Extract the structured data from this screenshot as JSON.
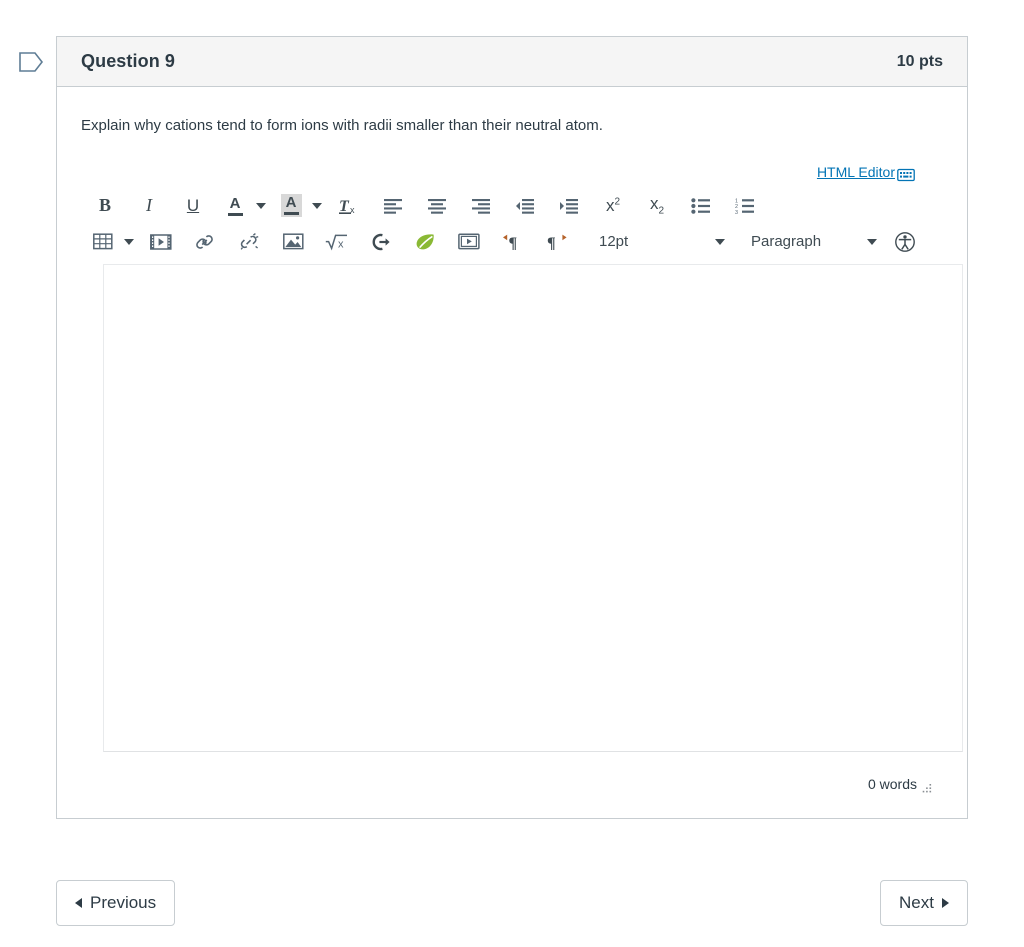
{
  "question": {
    "flag_icon": "flag-bookmark-icon",
    "title": "Question 9",
    "points": "10 pts",
    "prompt": "Explain why cations tend to form ions with radii smaller than their neutral atom."
  },
  "editor": {
    "html_editor_link": "HTML Editor",
    "html_editor_icon": "keyboard-icon",
    "content": "",
    "word_count": "0 words",
    "resize_handle_icon": "resize-grip-icon",
    "toolbar_row1": [
      {
        "name": "bold-button",
        "label": "B",
        "icon": "bold-icon"
      },
      {
        "name": "italic-button",
        "label": "I",
        "icon": "italic-icon"
      },
      {
        "name": "underline-button",
        "label": "U",
        "icon": "underline-icon"
      },
      {
        "name": "text-color-button",
        "label": "A",
        "icon": "text-color-icon"
      },
      {
        "name": "text-color-dropdown",
        "label": "",
        "icon": "chevron-down-icon"
      },
      {
        "name": "highlight-color-button",
        "label": "A",
        "icon": "highlight-color-icon"
      },
      {
        "name": "highlight-color-dropdown",
        "label": "",
        "icon": "chevron-down-icon"
      },
      {
        "name": "clear-formatting-button",
        "label": "Tx",
        "icon": "clear-formatting-icon"
      },
      {
        "name": "align-left-button",
        "label": "",
        "icon": "align-left-icon"
      },
      {
        "name": "align-center-button",
        "label": "",
        "icon": "align-center-icon"
      },
      {
        "name": "align-right-button",
        "label": "",
        "icon": "align-right-icon"
      },
      {
        "name": "outdent-button",
        "label": "",
        "icon": "outdent-icon"
      },
      {
        "name": "indent-button",
        "label": "",
        "icon": "indent-icon"
      },
      {
        "name": "superscript-button",
        "label": "x2",
        "icon": "superscript-icon"
      },
      {
        "name": "subscript-button",
        "label": "x2",
        "icon": "subscript-icon"
      },
      {
        "name": "bulleted-list-button",
        "label": "",
        "icon": "bulleted-list-icon"
      },
      {
        "name": "numbered-list-button",
        "label": "",
        "icon": "numbered-list-icon"
      }
    ],
    "toolbar_row2": [
      {
        "name": "table-button",
        "label": "",
        "icon": "table-icon"
      },
      {
        "name": "table-dropdown",
        "label": "",
        "icon": "chevron-down-icon"
      },
      {
        "name": "media-button",
        "label": "",
        "icon": "media-film-icon"
      },
      {
        "name": "link-button",
        "label": "",
        "icon": "link-icon"
      },
      {
        "name": "unlink-button",
        "label": "",
        "icon": "unlink-icon"
      },
      {
        "name": "image-button",
        "label": "",
        "icon": "image-icon"
      },
      {
        "name": "math-equation-button",
        "label": "",
        "icon": "square-root-icon"
      },
      {
        "name": "embed-button",
        "label": "",
        "icon": "arrow-exit-icon"
      },
      {
        "name": "studio-button",
        "label": "",
        "icon": "leaf-icon"
      },
      {
        "name": "record-video-button",
        "label": "",
        "icon": "video-play-icon"
      },
      {
        "name": "ltr-direction-button",
        "label": "",
        "icon": "paragraph-ltr-icon"
      },
      {
        "name": "rtl-direction-button",
        "label": "",
        "icon": "paragraph-rtl-icon"
      }
    ],
    "font_size": {
      "name": "font-size-select",
      "value": "12pt"
    },
    "block_format": {
      "name": "block-format-select",
      "value": "Paragraph"
    },
    "accessibility_checker": {
      "name": "accessibility-checker-button",
      "icon": "accessibility-person-icon"
    }
  },
  "navigation": {
    "previous_label": "Previous",
    "next_label": "Next",
    "previous_icon": "triangle-left-icon",
    "next_icon": "triangle-right-icon"
  },
  "colors": {
    "link": "#0374b5",
    "text": "#2d3b45",
    "border": "#c7cdd1",
    "header_bg": "#f5f5f5",
    "icon": "#556572",
    "leaf_green": "#8ab934"
  }
}
